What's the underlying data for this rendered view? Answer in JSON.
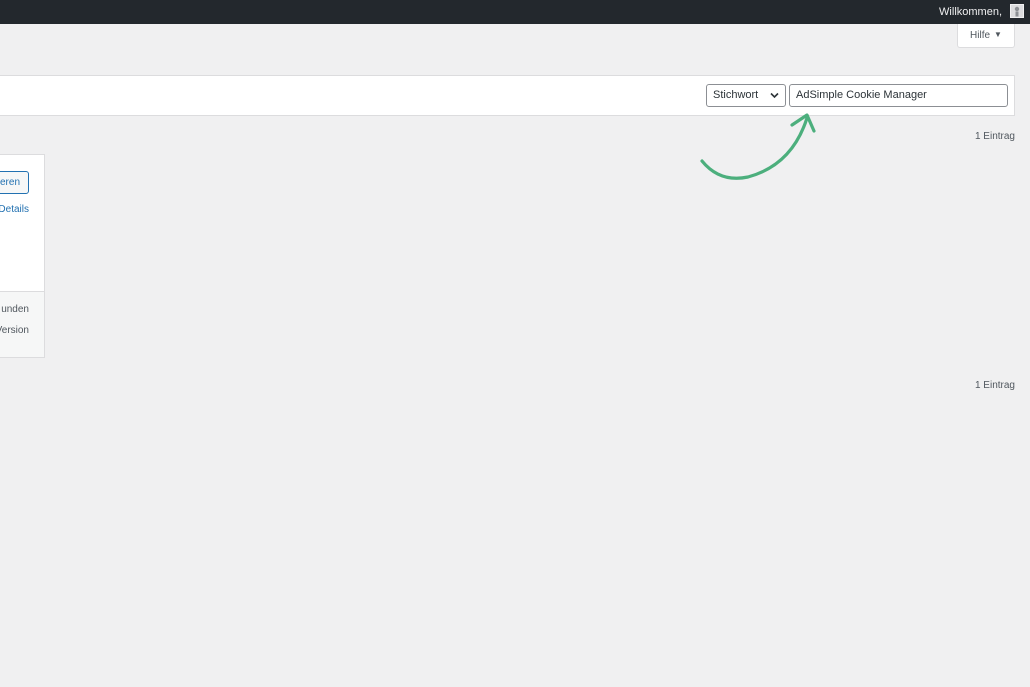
{
  "adminbar": {
    "greeting": "Willkommen,",
    "avatar_icon": "user-avatar-icon"
  },
  "help_tab": {
    "label": "Hilfe",
    "caret": "▼"
  },
  "filter": {
    "type_select": "Stichwort",
    "search_value": "AdSimple Cookie Manager"
  },
  "results": {
    "count_top": "1 Eintrag",
    "count_bottom": "1 Eintrag"
  },
  "plugin_card": {
    "action_label": "eren",
    "details_link": "Details",
    "meta_line_1": "unden",
    "meta_line_2": "Version"
  },
  "colors": {
    "adminbar_bg": "#23282d",
    "accent_blue": "#2271b1",
    "annotation_arrow": "#4caf7d",
    "page_bg": "#f0f0f1"
  }
}
